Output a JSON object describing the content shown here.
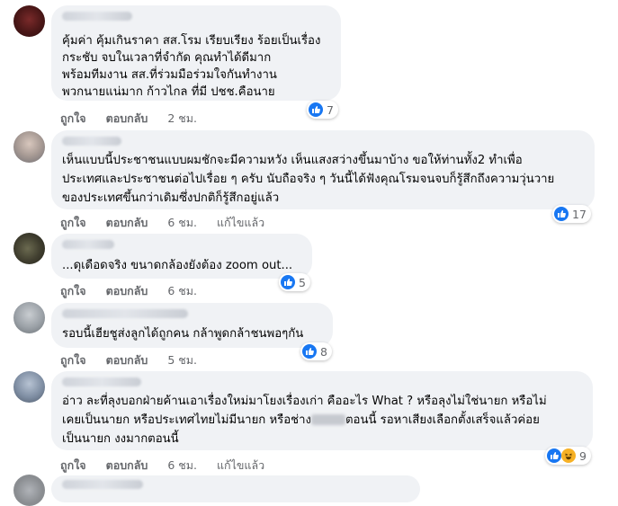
{
  "comments": [
    {
      "lines": [
        "คุ้มค่า คุ้มเกินราคา สส.โรม เรียบเรียง ร้อยเป็นเรื่อง",
        "กระชับ จบในเวลาที่จำกัด คุณทำได้ดีมาก",
        "พร้อมทีมงาน สส.ที่ร่วมมือร่วมใจกันทำงาน",
        "พวกนายแน่มาก ก้าวไกล ที่มี ปชช.คือนาย"
      ],
      "like_label": "ถูกใจ",
      "reply_label": "ตอบกลับ",
      "time": "2 ชม.",
      "reactions": "7",
      "reaction_icons": [
        "like-icon"
      ]
    },
    {
      "lines": [
        "เห็นแบบนี้ประชาชนแบบผมชักจะมีความหวัง เห็นแสงสว่างขึ้นมาบ้าง ขอให้ท่านทั้ง2 ทำเพื่อ",
        "ประเทศและประชาชนต่อไปเรื่อย ๆ ครับ นับถือจริง ๆ วันนี้ได้ฟังคุณโรมจนจบก็รู้สึกถึงความวุ่นวาย",
        "ของประเทศขึ้นกว่าเดิมซึ่งปกติก็รู้สึกอยู่แล้ว"
      ],
      "like_label": "ถูกใจ",
      "reply_label": "ตอบกลับ",
      "time": "6 ชม.",
      "edited": "แก้ไขแล้ว",
      "reactions": "17",
      "reaction_icons": [
        "like-icon"
      ]
    },
    {
      "lines": [
        "...ดุเดือดจริง ขนาดกล้องยังต้อง zoom out..."
      ],
      "like_label": "ถูกใจ",
      "reply_label": "ตอบกลับ",
      "time": "6 ชม.",
      "reactions": "5",
      "reaction_icons": [
        "like-icon"
      ]
    },
    {
      "lines": [
        "รอบนี้เฮียชูส่งลูกได้ถูกคน กล้าพูดกล้าชนพอๆกัน"
      ],
      "like_label": "ถูกใจ",
      "reply_label": "ตอบกลับ",
      "time": "5 ชม.",
      "reactions": "8",
      "reaction_icons": [
        "like-icon"
      ]
    },
    {
      "lines": [
        "อ่าว ละที่ลุงบอกฝ่ายค้านเอาเรื่องใหม่มาโยงเรื่องเก่า คืออะไร What ? หรือลุงไม่ใช่นายก หรือไม่",
        "เคยเป็นนายก หรือประเทศไทยไม่มีนายก หรือช่าง",
        "เป็นนายก งงมากตอนนี้"
      ],
      "line2_tail": "ตอนนี้ รอหาเสียงเลือกตั้งเสร็จแล้วค่อย",
      "like_label": "ถูกใจ",
      "reply_label": "ตอบกลับ",
      "time": "6 ชม.",
      "edited": "แก้ไขแล้ว",
      "reactions": "9",
      "reaction_icons": [
        "like-icon",
        "haha-icon"
      ]
    }
  ],
  "colors": {
    "bubble": "#f0f2f5",
    "like_blue": "#1877f2",
    "meta_gray": "#65676b"
  }
}
